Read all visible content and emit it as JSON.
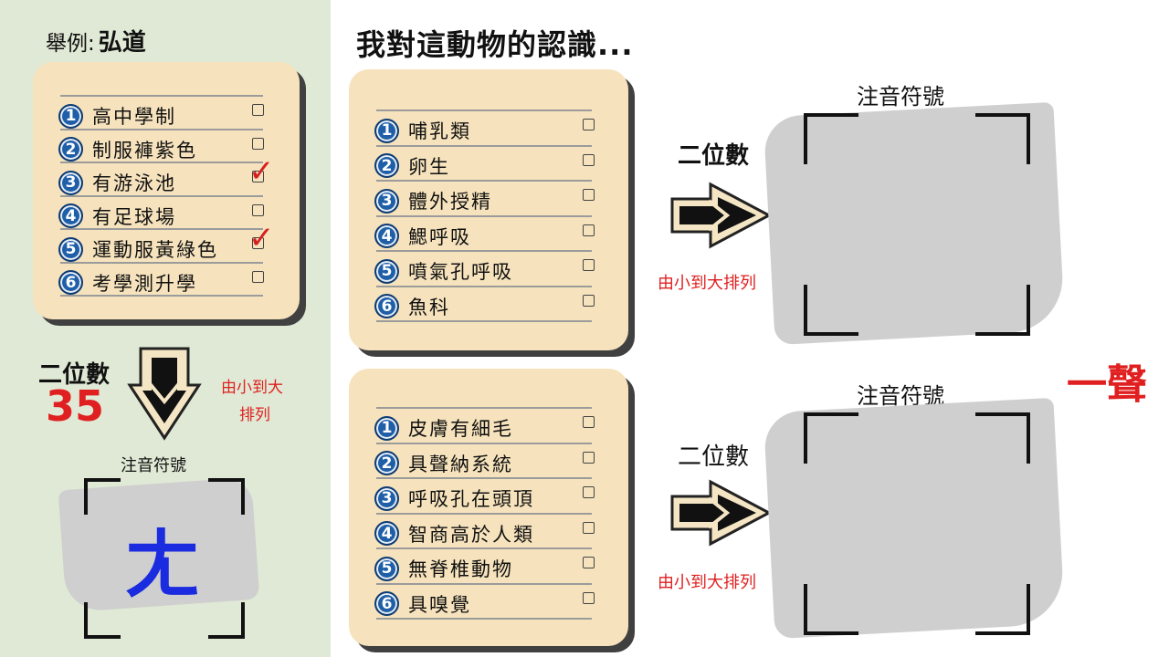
{
  "example": {
    "prefix": "舉例:",
    "word": "弘道",
    "items": [
      {
        "n": "1",
        "text": "高中學制",
        "checked": false
      },
      {
        "n": "2",
        "text": "制服褲紫色",
        "checked": false
      },
      {
        "n": "3",
        "text": "有游泳池",
        "checked": true
      },
      {
        "n": "4",
        "text": "有足球場",
        "checked": false
      },
      {
        "n": "5",
        "text": "運動服黃綠色",
        "checked": true
      },
      {
        "n": "6",
        "text": "考學測升學",
        "checked": false
      }
    ],
    "two_digit_label": "二位數",
    "number": "35",
    "sort_text_line1": "由小到大",
    "sort_text_line2": "排列",
    "zhuyin_label": "注音符號",
    "answer": "ㄤ"
  },
  "main": {
    "title": "我對這動物的認識...",
    "card1": {
      "items": [
        {
          "n": "1",
          "text": "哺乳類"
        },
        {
          "n": "2",
          "text": "卵生"
        },
        {
          "n": "3",
          "text": "體外授精"
        },
        {
          "n": "4",
          "text": "鰓呼吸"
        },
        {
          "n": "5",
          "text": "噴氣孔呼吸"
        },
        {
          "n": "6",
          "text": "魚科"
        }
      ],
      "two_digit_label": "二位數",
      "sort_text": "由小到大排列",
      "zhuyin_label": "注音符號"
    },
    "card2": {
      "items": [
        {
          "n": "1",
          "text": "皮膚有細毛"
        },
        {
          "n": "2",
          "text": "具聲納系統"
        },
        {
          "n": "3",
          "text": "呼吸孔在頭頂"
        },
        {
          "n": "4",
          "text": "智商高於人類"
        },
        {
          "n": "5",
          "text": "無脊椎動物"
        },
        {
          "n": "6",
          "text": "具嗅覺"
        }
      ],
      "two_digit_label": "二位數",
      "sort_text": "由小到大排列",
      "zhuyin_label": "注音符號"
    },
    "side_text": "一聲"
  },
  "colors": {
    "left_bg": "#dfe9d5",
    "card": "#f6e3bd",
    "number_badge": "#1f5fa8",
    "red": "#e02020",
    "answer_blue": "#1a2be0"
  }
}
